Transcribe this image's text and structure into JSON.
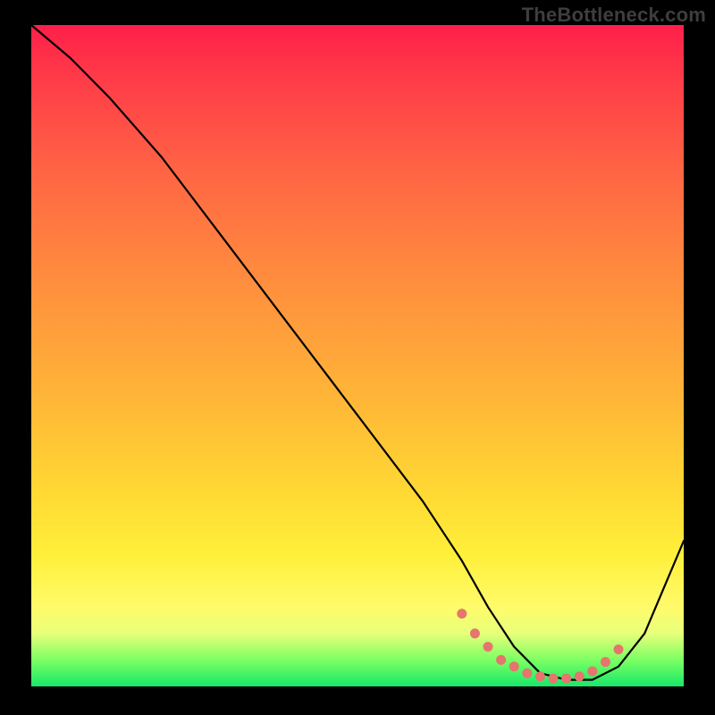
{
  "watermark": "TheBottleneck.com",
  "chart_data": {
    "type": "line",
    "title": "",
    "xlabel": "",
    "ylabel": "",
    "xlim": [
      0,
      100
    ],
    "ylim": [
      0,
      100
    ],
    "series": [
      {
        "name": "bottleneck-curve",
        "x": [
          0,
          6,
          12,
          20,
          30,
          40,
          50,
          60,
          66,
          70,
          74,
          78,
          82,
          86,
          90,
          94,
          100
        ],
        "y": [
          100,
          95,
          89,
          80,
          67,
          54,
          41,
          28,
          19,
          12,
          6,
          2,
          1,
          1,
          3,
          8,
          22
        ]
      }
    ],
    "highlight": {
      "name": "optimal-zone",
      "color": "#e6756d",
      "points_x": [
        66,
        68,
        70,
        72,
        74,
        76,
        78,
        80,
        82,
        84,
        86,
        88,
        90
      ],
      "points_y": [
        11,
        8,
        6,
        4,
        3,
        2,
        1.5,
        1.2,
        1.2,
        1.5,
        2.3,
        3.7,
        5.6
      ]
    }
  }
}
